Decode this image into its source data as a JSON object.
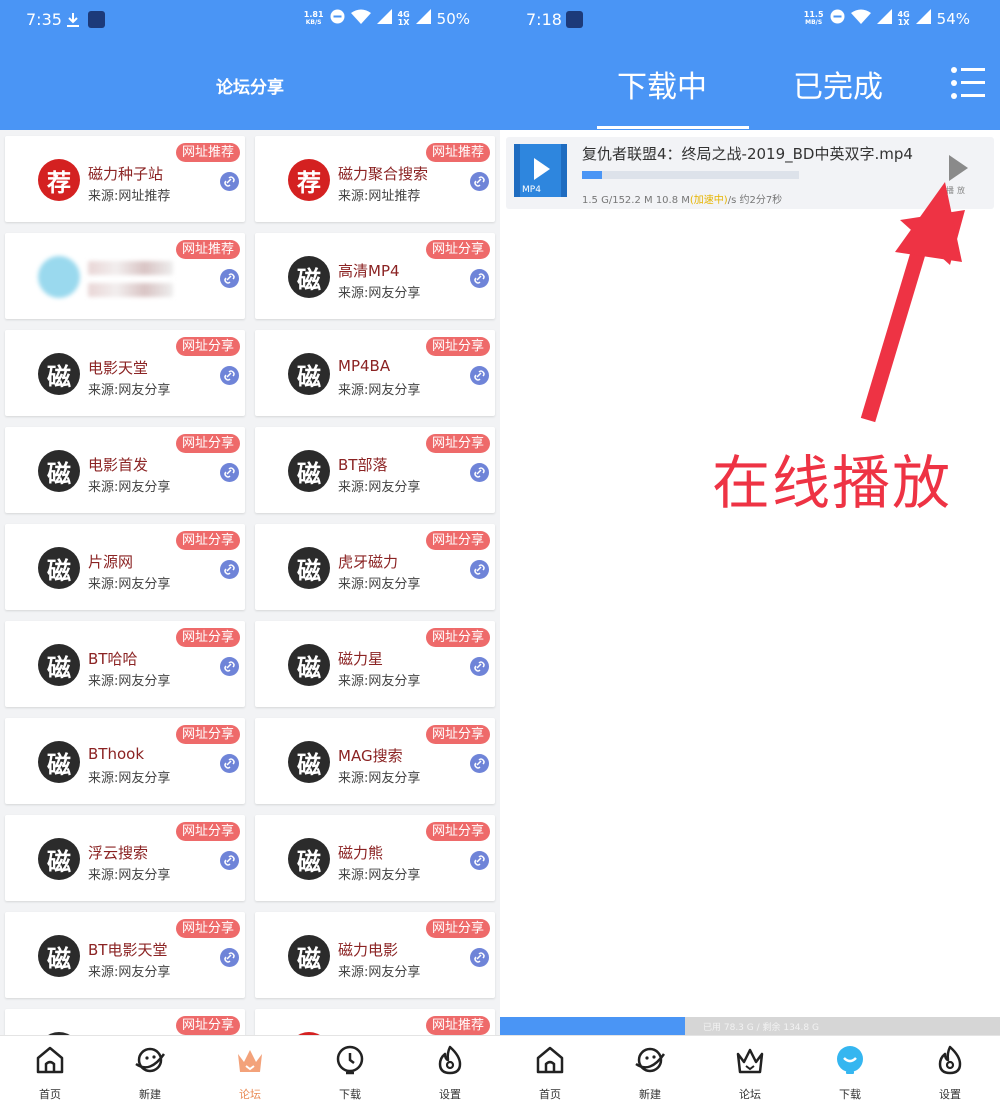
{
  "left": {
    "status": {
      "time": "7:35",
      "net_speed_value": "1.81",
      "net_speed_unit": "KB/S",
      "net_type_top": "4G",
      "net_type_bottom": "1X",
      "battery": "50%"
    },
    "title": "论坛分享",
    "sites": [
      {
        "name": "磁力种子站",
        "source": "来源:网址推荐",
        "badge": "网址推荐",
        "avatar": "荐",
        "avatar_color": "#d42121"
      },
      {
        "name": "磁力聚合搜索",
        "source": "来源:网址推荐",
        "badge": "网址推荐",
        "avatar": "荐",
        "avatar_color": "#d42121"
      },
      {
        "name": "",
        "source": "",
        "badge": "网址推荐",
        "avatar": "",
        "avatar_color": "#9ad9ee",
        "blurred": true
      },
      {
        "name": "高清MP4",
        "source": "来源:网友分享",
        "badge": "网址分享",
        "avatar": "磁",
        "avatar_color": "#2b2b2b"
      },
      {
        "name": "电影天堂",
        "source": "来源:网友分享",
        "badge": "网址分享",
        "avatar": "磁",
        "avatar_color": "#2b2b2b"
      },
      {
        "name": "MP4BA",
        "source": "来源:网友分享",
        "badge": "网址分享",
        "avatar": "磁",
        "avatar_color": "#2b2b2b"
      },
      {
        "name": "电影首发",
        "source": "来源:网友分享",
        "badge": "网址分享",
        "avatar": "磁",
        "avatar_color": "#2b2b2b"
      },
      {
        "name": "BT部落",
        "source": "来源:网友分享",
        "badge": "网址分享",
        "avatar": "磁",
        "avatar_color": "#2b2b2b"
      },
      {
        "name": "片源网",
        "source": "来源:网友分享",
        "badge": "网址分享",
        "avatar": "磁",
        "avatar_color": "#2b2b2b"
      },
      {
        "name": "虎牙磁力",
        "source": "来源:网友分享",
        "badge": "网址分享",
        "avatar": "磁",
        "avatar_color": "#2b2b2b"
      },
      {
        "name": "BT哈哈",
        "source": "来源:网友分享",
        "badge": "网址分享",
        "avatar": "磁",
        "avatar_color": "#2b2b2b"
      },
      {
        "name": "磁力星",
        "source": "来源:网友分享",
        "badge": "网址分享",
        "avatar": "磁",
        "avatar_color": "#2b2b2b"
      },
      {
        "name": "BThook",
        "source": "来源:网友分享",
        "badge": "网址分享",
        "avatar": "磁",
        "avatar_color": "#2b2b2b"
      },
      {
        "name": "MAG搜索",
        "source": "来源:网友分享",
        "badge": "网址分享",
        "avatar": "磁",
        "avatar_color": "#2b2b2b"
      },
      {
        "name": "浮云搜索",
        "source": "来源:网友分享",
        "badge": "网址分享",
        "avatar": "磁",
        "avatar_color": "#2b2b2b"
      },
      {
        "name": "磁力熊",
        "source": "来源:网友分享",
        "badge": "网址分享",
        "avatar": "磁",
        "avatar_color": "#2b2b2b"
      },
      {
        "name": "BT电影天堂",
        "source": "来源:网友分享",
        "badge": "网址分享",
        "avatar": "磁",
        "avatar_color": "#2b2b2b"
      },
      {
        "name": "磁力电影",
        "source": "来源:网友分享",
        "badge": "网址分享",
        "avatar": "磁",
        "avatar_color": "#2b2b2b"
      },
      {
        "name": "",
        "source": "",
        "badge": "网址分享",
        "avatar": "",
        "avatar_color": "#2b2b2b"
      },
      {
        "name": "",
        "source": "",
        "badge": "网址推荐",
        "avatar": "",
        "avatar_color": "#d42121"
      }
    ],
    "nav": [
      {
        "label": "首页",
        "icon": "home-icon"
      },
      {
        "label": "新建",
        "icon": "planet-icon"
      },
      {
        "label": "论坛",
        "icon": "crown-icon",
        "active": true
      },
      {
        "label": "下载",
        "icon": "download-face-icon"
      },
      {
        "label": "设置",
        "icon": "flame-icon"
      }
    ]
  },
  "right": {
    "status": {
      "time": "7:18",
      "net_speed_value": "11.5",
      "net_speed_unit": "MB/S",
      "net_type_top": "4G",
      "net_type_bottom": "1X",
      "battery": "54%"
    },
    "tabs": {
      "downloading": "下载中",
      "completed": "已完成"
    },
    "download": {
      "title": "复仇者联盟4：终局之战-2019_BD中英双字.mp4",
      "file_type": "MP4",
      "progress": 0.09,
      "size_info": "1.5 G/152.2 M 10.8 M",
      "accel": "(加速中)",
      "eta": "/s 约2分7秒",
      "play_label": "播放"
    },
    "annotation": "在线播放",
    "storage": {
      "text": "已用 78.3 G / 剩余 134.8 G",
      "used_fraction": 0.37
    },
    "nav": [
      {
        "label": "首页",
        "icon": "home-icon"
      },
      {
        "label": "新建",
        "icon": "planet-icon"
      },
      {
        "label": "论坛",
        "icon": "crown-icon"
      },
      {
        "label": "下载",
        "icon": "download-face-icon",
        "active": true
      },
      {
        "label": "设置",
        "icon": "flame-icon"
      }
    ]
  },
  "colors": {
    "primary": "#4a95f5",
    "badge": "#ee6a6a",
    "accent_orange": "#e98b55",
    "annotation_red": "#ee3344",
    "site_name": "#8b2323"
  }
}
